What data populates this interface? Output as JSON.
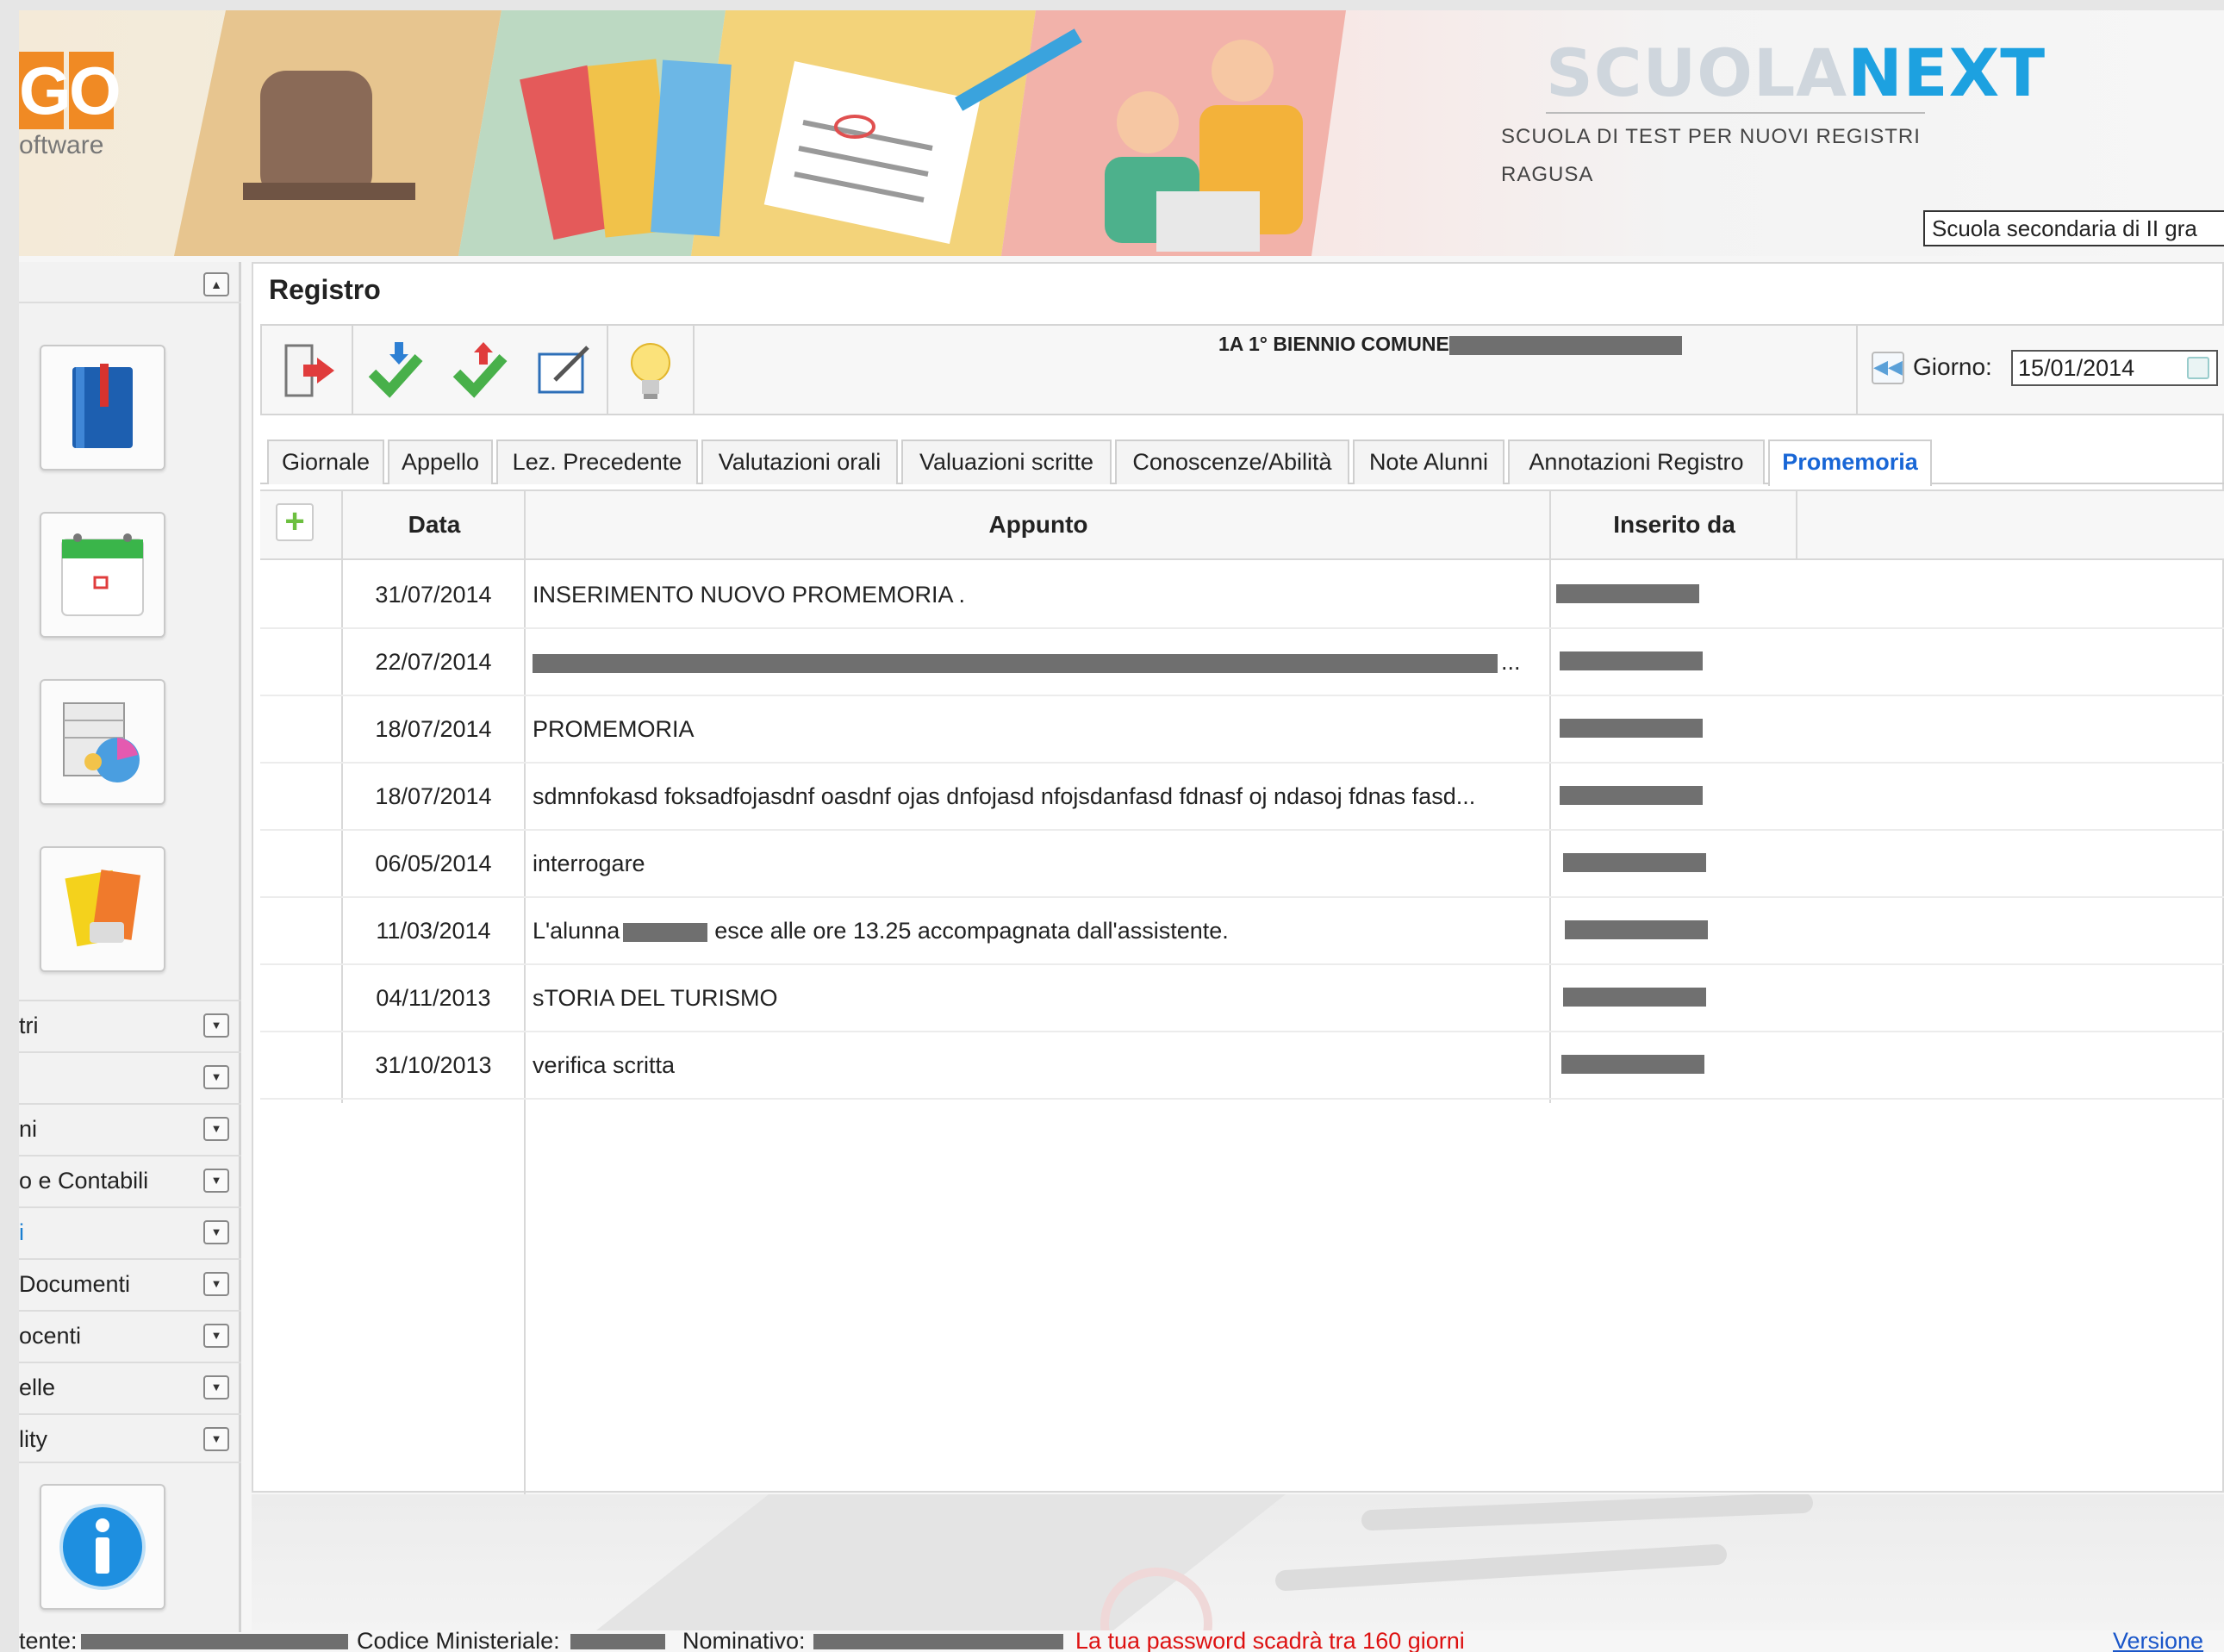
{
  "header": {
    "logo_letters": [
      "G",
      "O"
    ],
    "logo_sub": "oftware",
    "brand_first": "SCUOLA",
    "brand_second": "NEXT",
    "school_name": "SCUOLA DI TEST PER NUOVI REGISTRI",
    "school_city": "RAGUSA",
    "school_select_value": "Scuola secondaria di II gra"
  },
  "sidebar": {
    "tiles": [
      {
        "icon": "register-book-icon"
      },
      {
        "icon": "calendar-icon"
      },
      {
        "icon": "spreadsheet-chart-icon"
      },
      {
        "icon": "notes-folder-icon"
      }
    ],
    "menu": [
      {
        "label": "tri"
      },
      {
        "label": ""
      },
      {
        "label": "ni"
      },
      {
        "label": "o e Contabili"
      },
      {
        "label": "i"
      },
      {
        "label": "Documenti"
      },
      {
        "label": "ocenti"
      },
      {
        "label": "elle"
      },
      {
        "label": "lity"
      }
    ],
    "info_icon": "info-icon"
  },
  "main": {
    "title": "Registro",
    "class_title": "1A 1° BIENNIO COMUNE",
    "day_label": "Giorno:",
    "day_value": "15/01/2014",
    "tabs": [
      {
        "label": "Giornale"
      },
      {
        "label": "Appello"
      },
      {
        "label": "Lez. Precedente"
      },
      {
        "label": "Valutazioni orali"
      },
      {
        "label": "Valuazioni scritte"
      },
      {
        "label": "Conoscenze/Abilità"
      },
      {
        "label": "Note Alunni"
      },
      {
        "label": "Annotazioni Registro"
      },
      {
        "label": "Promemoria"
      }
    ],
    "active_tab": "Promemoria",
    "columns": {
      "date": "Data",
      "note": "Appunto",
      "by": "Inserito da"
    },
    "rows": [
      {
        "date": "31/07/2014",
        "note": "INSERIMENTO NUOVO PROMEMORIA ."
      },
      {
        "date": "22/07/2014",
        "note": "..."
      },
      {
        "date": "18/07/2014",
        "note": "PROMEMORIA"
      },
      {
        "date": "18/07/2014",
        "note": "sdmnfokasd foksadfojasdnf oasdnf ojas dnfojasd nfojsdanfasd fdnasf oj ndasoj fdnas fasd..."
      },
      {
        "date": "06/05/2014",
        "note": "interrogare"
      },
      {
        "date": "11/03/2014",
        "note_prefix": "L'alunna",
        "note_suffix": "esce alle ore 13.25 accompagnata dall'assistente."
      },
      {
        "date": "04/11/2013",
        "note": "sTORIA DEL TURISMO"
      },
      {
        "date": "31/10/2013",
        "note": "verifica scritta"
      }
    ]
  },
  "status": {
    "user_label": "tente:",
    "code_label": "Codice Ministeriale:",
    "name_label": "Nominativo:",
    "warning": "La tua password scadrà tra 160 giorni",
    "version": "Versione"
  },
  "colors": {
    "accent": "#1866d6",
    "brand_blue": "#1da1e0",
    "logo_orange": "#f08a24",
    "warning_red": "#dd1111"
  }
}
